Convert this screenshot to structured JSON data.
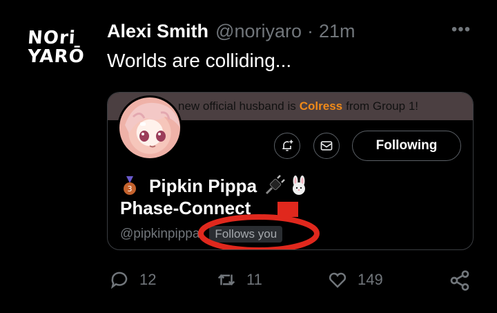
{
  "post": {
    "logo_line1": "NOri",
    "logo_line2": "YARŌ",
    "author_name": "Alexi Smith",
    "author_handle": "@noriyaro",
    "separator": "·",
    "time": "21m",
    "more_icon": "more-dots-icon",
    "text": "Worlds are colliding..."
  },
  "card": {
    "banner_prefix": "new official husband is",
    "banner_highlight": "Colress",
    "banner_suffix": "from Group 1!",
    "banner_highlight_color": "#f08a19",
    "following_label": "Following",
    "display_name": "Pipkin Pippa",
    "agency": "Phase-Connect",
    "handle": "@pipkinpippa",
    "follows_you": "Follows you",
    "annotation_color": "#e0281d"
  },
  "actions": {
    "replies": "12",
    "retweets": "11",
    "likes": "149"
  }
}
